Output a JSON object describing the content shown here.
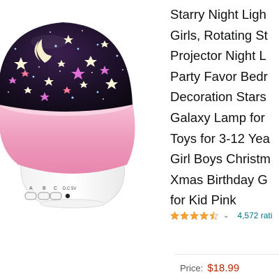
{
  "product": {
    "title_lines": [
      "Starry Night Ligh",
      "Girls, Rotating St",
      "Projector Night L",
      "Party Favor Bedr",
      "Decoration Stars",
      "Galaxy Lamp for",
      "Toys for 3-12 Yea",
      "Girl Boys Christm",
      "Xmas Birthday G",
      "for Kid Pink"
    ],
    "rating": {
      "stars": 4.5,
      "count_text": "4,572 rati"
    },
    "price": {
      "label": "Price:",
      "value": "$18.99"
    },
    "base_buttons": {
      "a": "A",
      "b": "B",
      "c": "C",
      "dc": "D.C 5V"
    }
  },
  "colors": {
    "dome": "#1a0f24",
    "base_pink": "#f0a0c0",
    "star_fill": "#f5a623",
    "link": "#007185",
    "price": "#b12704"
  },
  "icons": {
    "rating_dropdown": "chevron-down-icon"
  }
}
